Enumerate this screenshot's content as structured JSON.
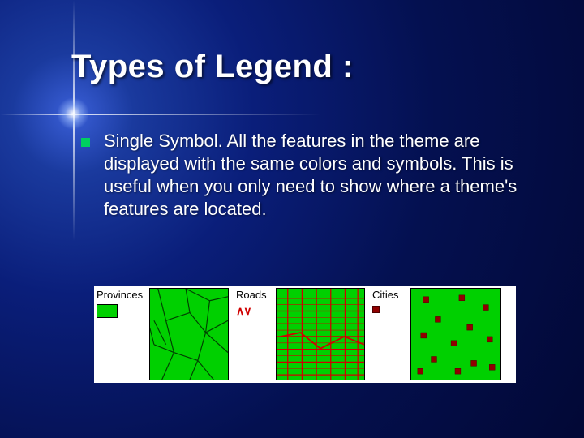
{
  "title": "Types of Legend :",
  "bullet_text": "Single Symbol. All the features in the theme are displayed with the same colors and symbols. This is useful when you only need to show where a theme's features are located.",
  "legend": {
    "provinces": {
      "label": "Provinces",
      "swatch_color": "#00d000"
    },
    "roads": {
      "label": "Roads",
      "swatch_glyph": "∧∨"
    },
    "cities": {
      "label": "Cities"
    }
  }
}
